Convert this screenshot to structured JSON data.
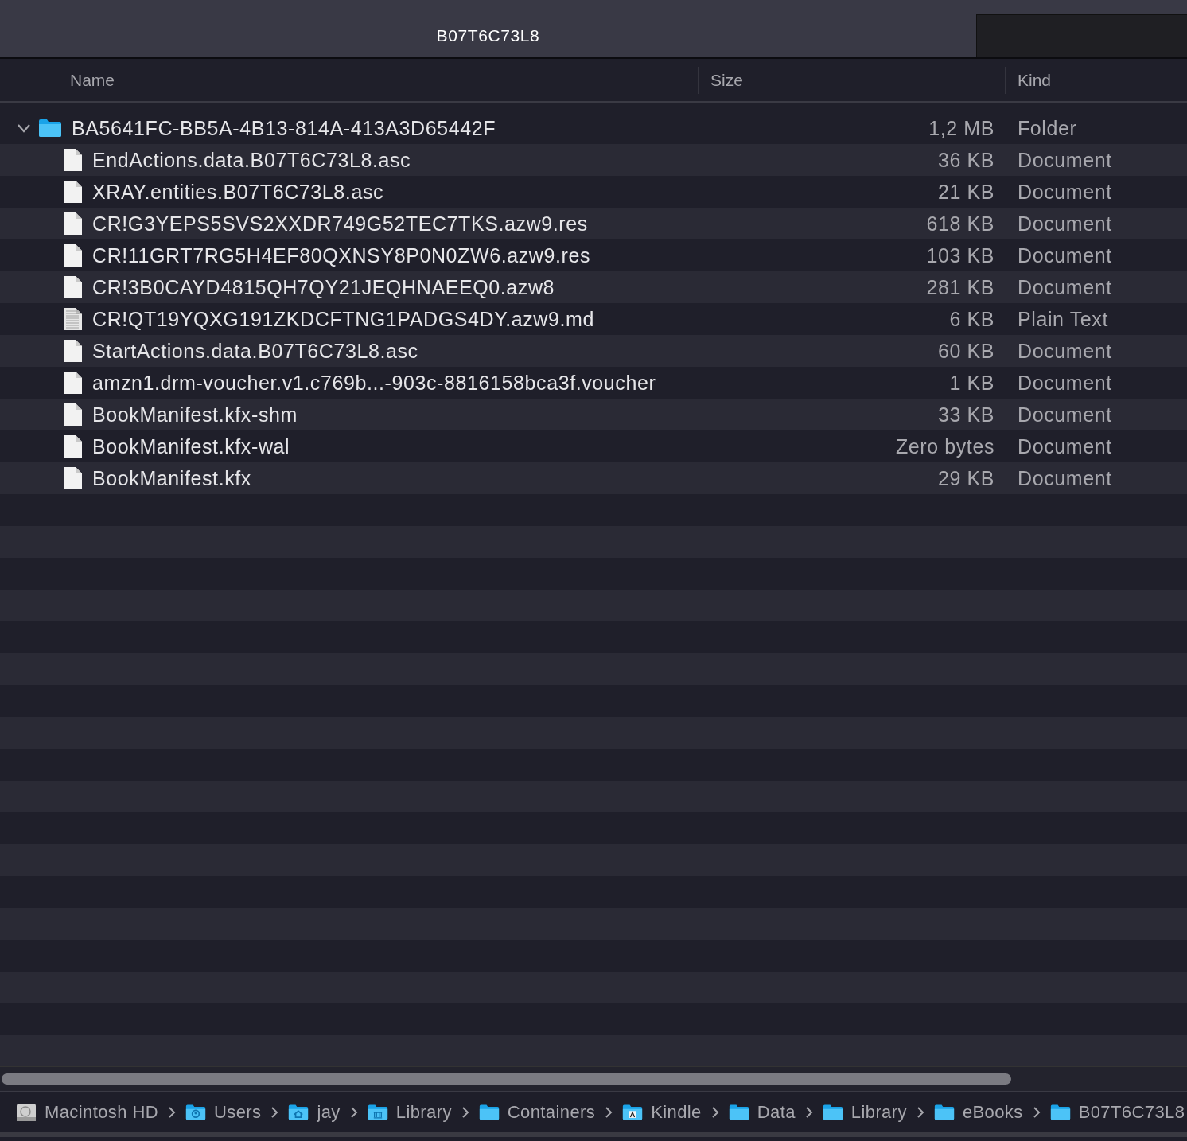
{
  "window": {
    "title": "B07T6C73L8"
  },
  "table": {
    "columns": [
      "Name",
      "Size",
      "Kind"
    ],
    "rows": [
      {
        "kind": "folder",
        "name": "BA5641FC-BB5A-4B13-814A-413A3D65442F",
        "size": "1,2 MB",
        "type": "Folder",
        "expanded": true,
        "children": [
          {
            "kind": "document",
            "name": "EndActions.data.B07T6C73L8.asc",
            "size": "36 KB",
            "type": "Document"
          },
          {
            "kind": "document",
            "name": "XRAY.entities.B07T6C73L8.asc",
            "size": "21 KB",
            "type": "Document"
          },
          {
            "kind": "document",
            "name": "CR!G3YEPS5SVS2XXDR749G52TEC7TKS.azw9.res",
            "size": "618 KB",
            "type": "Document"
          },
          {
            "kind": "document",
            "name": "CR!11GRT7RG5H4EF80QXNSY8P0N0ZW6.azw9.res",
            "size": "103 KB",
            "type": "Document"
          },
          {
            "kind": "document",
            "name": "CR!3B0CAYD4815QH7QY21JEQHNAEEQ0.azw8",
            "size": "281 KB",
            "type": "Document"
          },
          {
            "kind": "text",
            "name": "CR!QT19YQXG191ZKDCFTNG1PADGS4DY.azw9.md",
            "size": "6 KB",
            "type": "Plain Text"
          },
          {
            "kind": "document",
            "name": "StartActions.data.B07T6C73L8.asc",
            "size": "60 KB",
            "type": "Document"
          },
          {
            "kind": "document",
            "name": "amzn1.drm-voucher.v1.c769b...-903c-8816158bca3f.voucher",
            "size": "1 KB",
            "type": "Document"
          },
          {
            "kind": "document",
            "name": "BookManifest.kfx-shm",
            "size": "33 KB",
            "type": "Document"
          },
          {
            "kind": "document",
            "name": "BookManifest.kfx-wal",
            "size": "Zero bytes",
            "type": "Document"
          },
          {
            "kind": "document",
            "name": "BookManifest.kfx",
            "size": "29 KB",
            "type": "Document"
          }
        ]
      }
    ]
  },
  "path_bar": [
    {
      "kind": "disk",
      "label": "Macintosh HD"
    },
    {
      "kind": "users",
      "label": "Users"
    },
    {
      "kind": "home",
      "label": "jay"
    },
    {
      "kind": "library",
      "label": "Library"
    },
    {
      "kind": "folder",
      "label": "Containers"
    },
    {
      "kind": "app",
      "label": "Kindle"
    },
    {
      "kind": "folder",
      "label": "Data"
    },
    {
      "kind": "folder",
      "label": "Library"
    },
    {
      "kind": "folder",
      "label": "eBooks"
    },
    {
      "kind": "folder",
      "label": "B07T6C73L8"
    }
  ]
}
